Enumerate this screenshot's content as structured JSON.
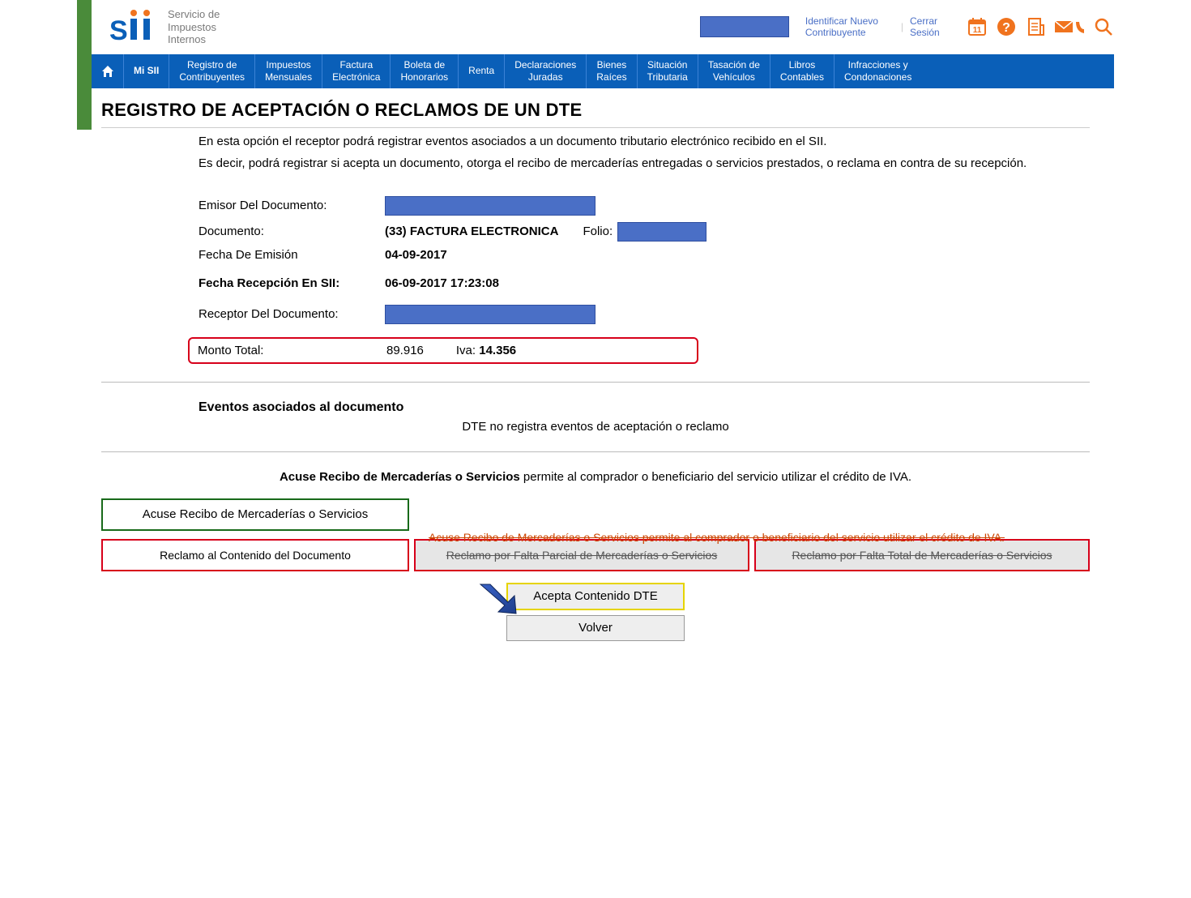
{
  "header": {
    "logo_subtitle": "Servicio de\nImpuestos\nInternos",
    "link_identificar": "Identificar Nuevo Contribuyente",
    "link_cerrar": "Cerrar Sesión"
  },
  "nav": {
    "items": [
      "Mi SII",
      "Registro de\nContribuyentes",
      "Impuestos\nMensuales",
      "Factura\nElectrónica",
      "Boleta de\nHonorarios",
      "Renta",
      "Declaraciones\nJuradas",
      "Bienes\nRaíces",
      "Situación\nTributaria",
      "Tasación de\nVehículos",
      "Libros\nContables",
      "Infracciones y\nCondonaciones"
    ]
  },
  "page_title": "REGISTRO DE ACEPTACIÓN O RECLAMOS DE UN DTE",
  "intro": {
    "p1": "En esta opción el receptor podrá registrar eventos asociados a un documento tributario electrónico recibido en el SII.",
    "p2": "Es decir, podrá registrar si acepta un documento, otorga el recibo de mercaderías entregadas o servicios prestados, o reclama en contra de su recepción."
  },
  "labels": {
    "emisor": "Emisor Del Documento:",
    "documento": "Documento:",
    "folio": "Folio:",
    "fecha_emision": "Fecha De Emisión",
    "fecha_recepcion": "Fecha Recepción En SII:",
    "receptor": "Receptor Del Documento:",
    "monto_total": "Monto Total:",
    "iva": "Iva:"
  },
  "values": {
    "documento": "(33) FACTURA ELECTRONICA",
    "fecha_emision": "04-09-2017",
    "fecha_recepcion": "06-09-2017 17:23:08",
    "monto_total": "89.916",
    "iva": "14.356"
  },
  "eventos": {
    "head": "Eventos asociados al documento",
    "msg": "DTE no registra eventos de aceptación o reclamo"
  },
  "acuse": {
    "bold": "Acuse Recibo de Mercaderías o Servicios",
    "rest": " permite al comprador o beneficiario del servicio utilizar el crédito de IVA."
  },
  "buttons": {
    "acuse": "Acuse Recibo de Mercaderías o Servicios",
    "reclamo_contenido": "Reclamo al Contenido del Documento",
    "reclamo_parcial": "Reclamo por Falta Parcial de Mercaderías o Servicios",
    "reclamo_total": "Reclamo por Falta Total de Mercaderías o Servicios",
    "overlay": "Acuse Recibo de Mercaderías o Servicios permite al comprador o beneficiario del servicio utilizar el crédito de IVA.",
    "acepta": "Acepta Contenido DTE",
    "volver": "Volver"
  }
}
